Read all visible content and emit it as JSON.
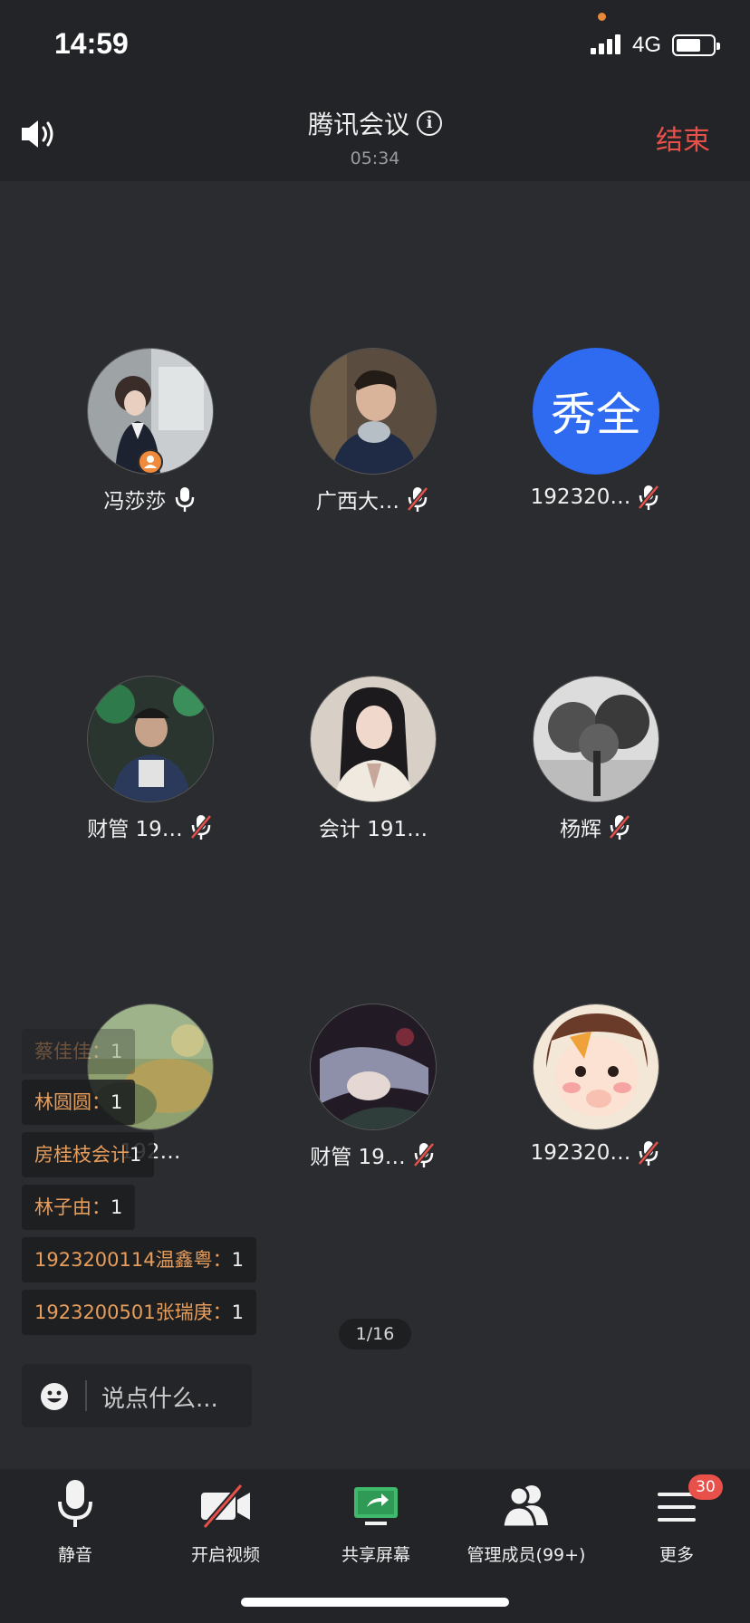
{
  "status_bar": {
    "time": "14:59",
    "network": "4G"
  },
  "header": {
    "title": "腾讯会议",
    "timer": "05:34",
    "end_label": "结束"
  },
  "participants": [
    {
      "name": "冯莎莎",
      "mic": "on",
      "host": true
    },
    {
      "name": "广西大…",
      "mic": "muted"
    },
    {
      "name": "192320…",
      "mic": "muted",
      "initials": "秀全",
      "avatar_color": "#2f6bf0"
    },
    {
      "name": "财管 19…",
      "mic": "muted"
    },
    {
      "name": "会计 191…",
      "mic": "none"
    },
    {
      "name": "杨辉",
      "mic": "muted"
    },
    {
      "name": "192…",
      "mic": "none"
    },
    {
      "name": "财管 19…",
      "mic": "muted"
    },
    {
      "name": "192320…",
      "mic": "muted"
    }
  ],
  "chat": [
    {
      "who": "蔡佳佳：",
      "text": "1"
    },
    {
      "who": "林圆圆：",
      "text": "1"
    },
    {
      "who": "房桂枝会计",
      "text": "1"
    },
    {
      "who": "林子由：",
      "text": "1"
    },
    {
      "who": "1923200114温鑫粤：",
      "text": "1"
    },
    {
      "who": "1923200501张瑞庚：",
      "text": "1"
    }
  ],
  "page_indicator": "1/16",
  "chat_input": {
    "placeholder": "说点什么..."
  },
  "toolbar": [
    {
      "label": "静音",
      "icon": "mic-icon"
    },
    {
      "label": "开启视频",
      "icon": "camera-off-icon"
    },
    {
      "label": "共享屏幕",
      "icon": "share-screen-icon"
    },
    {
      "label": "管理成员(99+)",
      "icon": "members-icon"
    },
    {
      "label": "更多",
      "icon": "menu-icon",
      "badge": "30"
    }
  ],
  "colors": {
    "accent_end": "#e8504a",
    "chat_name": "#e79d5c",
    "share_green": "#3fb96b"
  }
}
